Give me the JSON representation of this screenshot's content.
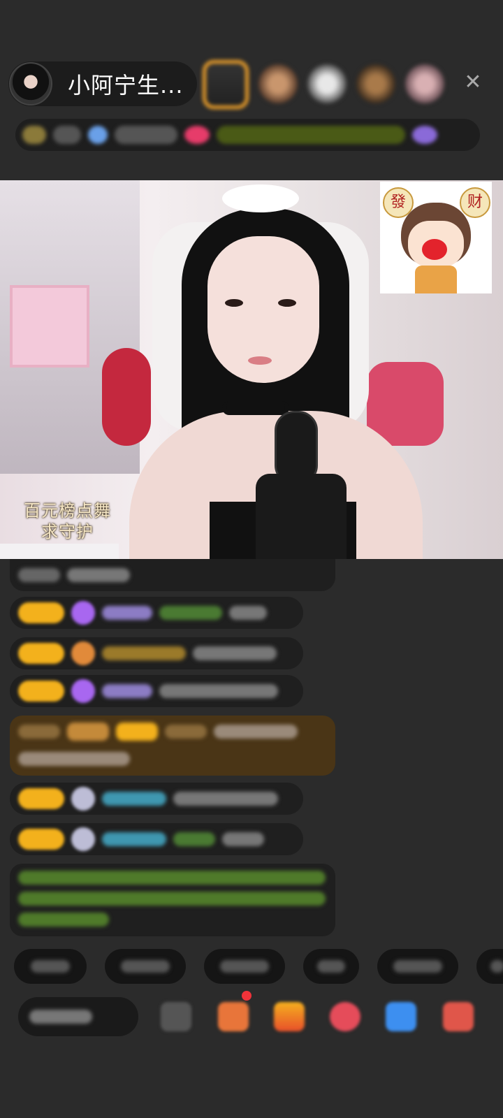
{
  "header": {
    "host_name": "小阿宁生...",
    "close_icon": "close-icon"
  },
  "video": {
    "caption_line1": "百元榜点舞",
    "caption_line2": "求守护",
    "sticker_chars": [
      "發",
      "财"
    ]
  },
  "colors": {
    "background": "#2b2b2b",
    "badge_gold": "#f3b11c",
    "highlight_brown": "#4a3516",
    "accent_green": "#7fbf3f",
    "accent_teal": "#49b3c9",
    "accent_purple": "#a867f0"
  },
  "icons": [
    "close-icon",
    "gift-box-icon",
    "emoji-icon",
    "share-icon",
    "more-icon"
  ]
}
